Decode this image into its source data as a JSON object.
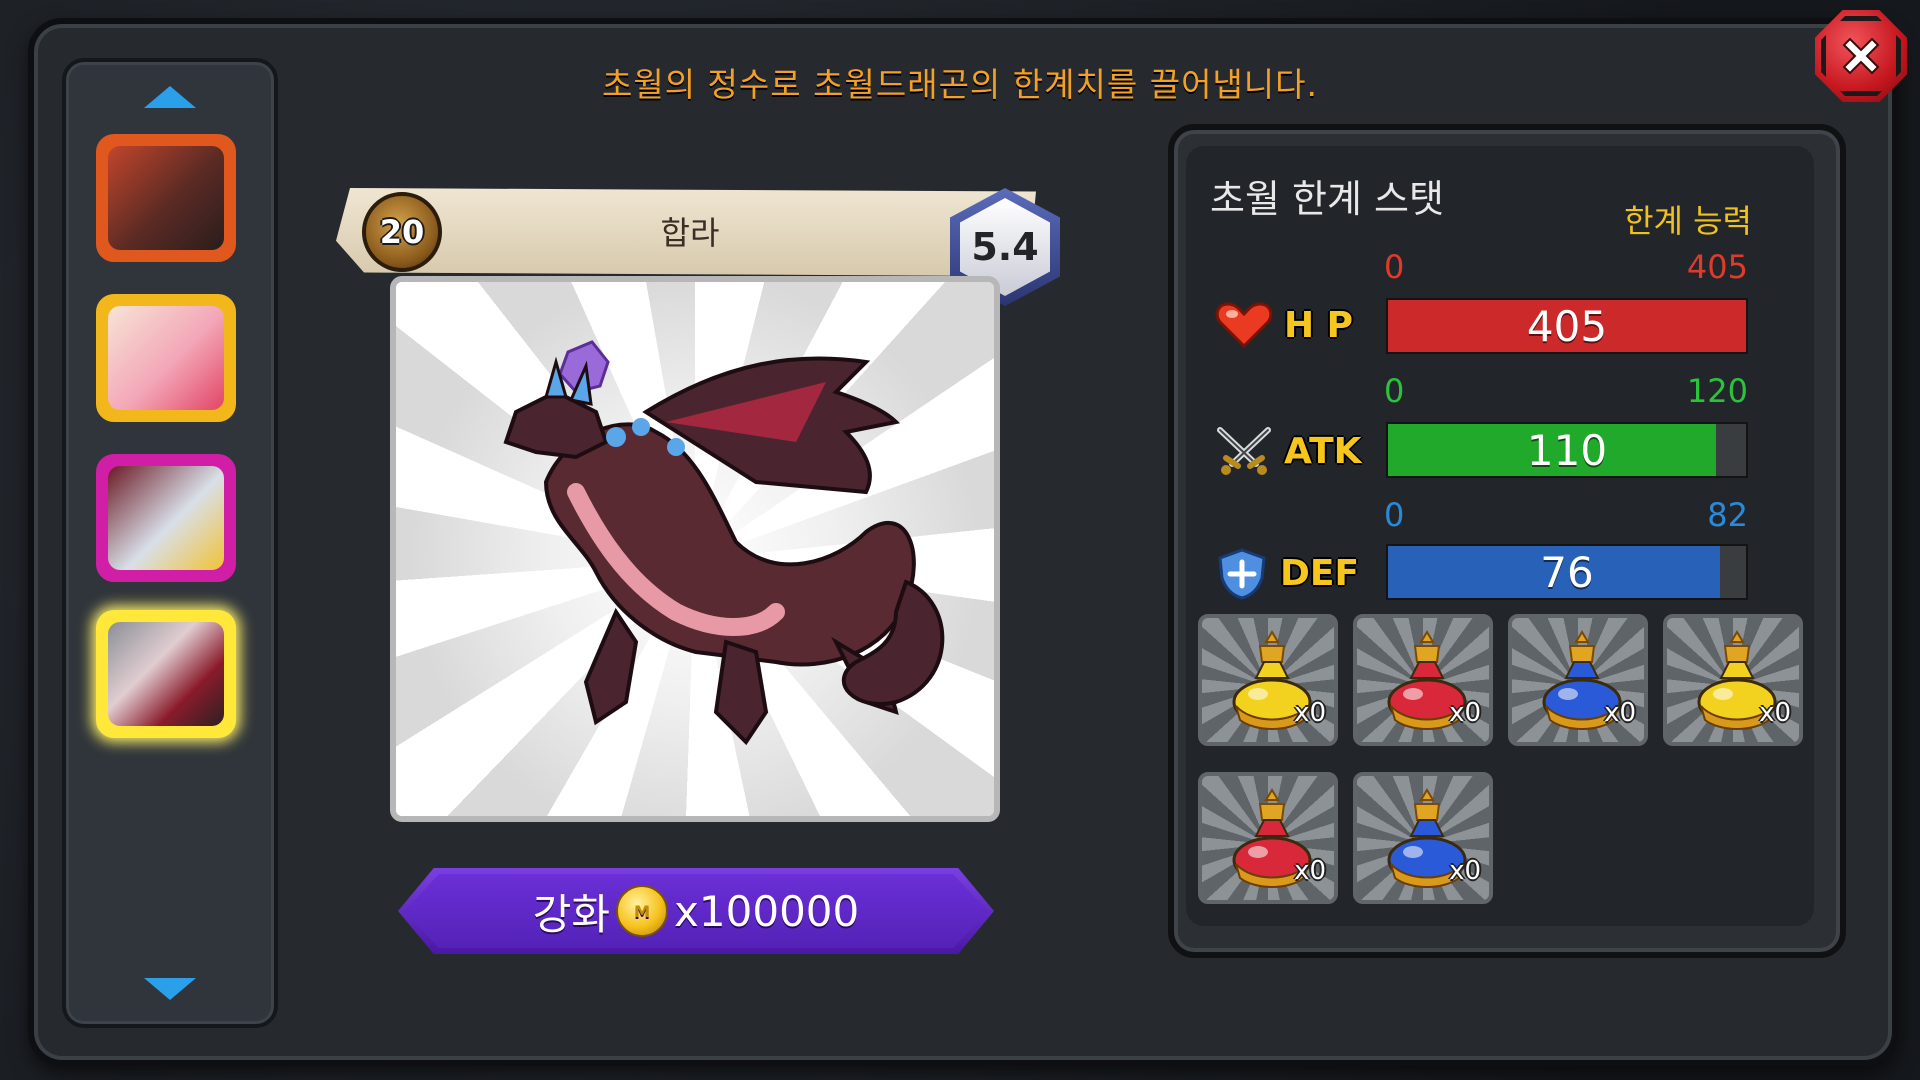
{
  "notice": "초월의 정수로 초월드래곤의 한계치를 끌어냅니다.",
  "dragon": {
    "level": "20",
    "name": "합라",
    "grade": "5.4"
  },
  "upgrade": {
    "label": "강화",
    "cost": "x100000",
    "coin_icon": "gold-coin-icon",
    "coin_mark": "M"
  },
  "stats": {
    "title": "초월 한계 스탯",
    "limit_label": "한계 능력",
    "hp": {
      "label": "H P",
      "min": "0",
      "max": "405",
      "value": "405",
      "fraction": 1.0,
      "color": "#cc2a2a",
      "range_color": "#e03a2a",
      "icon": "heart-icon"
    },
    "atk": {
      "label": "ATK",
      "min": "0",
      "max": "120",
      "value": "110",
      "fraction": 0.917,
      "color": "#20a92a",
      "range_color": "#29c43b",
      "icon": "crossed-swords-icon"
    },
    "def": {
      "label": "DEF",
      "min": "0",
      "max": "82",
      "value": "76",
      "fraction": 0.927,
      "color": "#2762b8",
      "range_color": "#2a8ad8",
      "icon": "shield-icon"
    }
  },
  "potions": [
    {
      "icon": "yellow-potion-icon",
      "count": "x0",
      "color": "#f2d21e"
    },
    {
      "icon": "red-potion-icon",
      "count": "x0",
      "color": "#d8283a"
    },
    {
      "icon": "blue-potion-icon",
      "count": "x0",
      "color": "#2a5ad8"
    },
    {
      "icon": "large-yellow-potion-icon",
      "count": "x0",
      "color": "#f2d21e"
    },
    {
      "icon": "large-red-potion-icon",
      "count": "x0",
      "color": "#d8283a"
    },
    {
      "icon": "large-blue-potion-icon",
      "count": "x0",
      "color": "#2a5ad8"
    }
  ],
  "sidebar": {
    "thumbnails": [
      {
        "name": "dragon-thumbnail-1",
        "border": "#e0581d"
      },
      {
        "name": "dragon-thumbnail-2",
        "border": "#f2b81b"
      },
      {
        "name": "dragon-thumbnail-3",
        "border": "#d11ea7"
      },
      {
        "name": "dragon-thumbnail-4",
        "border": "#ffe83a",
        "selected": true
      }
    ]
  }
}
